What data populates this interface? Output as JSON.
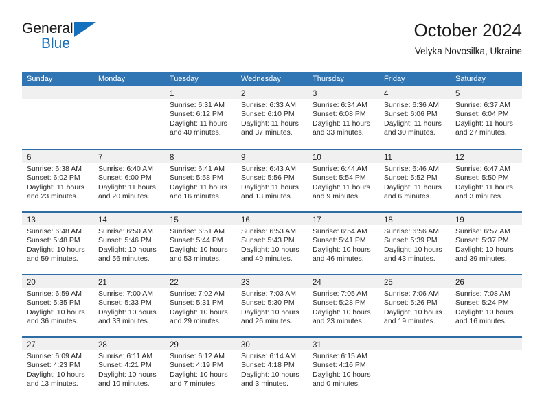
{
  "brand": {
    "name_top": "General",
    "name_bottom": "Blue",
    "accent_color": "#1570bd",
    "triangle_icon": "triangle-icon"
  },
  "header": {
    "title": "October 2024",
    "subtitle": "Velyka Novosilka, Ukraine"
  },
  "calendar": {
    "header_bg": "#3075b4",
    "row_divider_color": "#2e6da4",
    "daynum_band_color": "#f0f0f0",
    "weekdays": [
      "Sunday",
      "Monday",
      "Tuesday",
      "Wednesday",
      "Thursday",
      "Friday",
      "Saturday"
    ],
    "weeks": [
      [
        {
          "day": "",
          "lines": []
        },
        {
          "day": "",
          "lines": []
        },
        {
          "day": "1",
          "lines": [
            "Sunrise: 6:31 AM",
            "Sunset: 6:12 PM",
            "Daylight: 11 hours",
            "and 40 minutes."
          ]
        },
        {
          "day": "2",
          "lines": [
            "Sunrise: 6:33 AM",
            "Sunset: 6:10 PM",
            "Daylight: 11 hours",
            "and 37 minutes."
          ]
        },
        {
          "day": "3",
          "lines": [
            "Sunrise: 6:34 AM",
            "Sunset: 6:08 PM",
            "Daylight: 11 hours",
            "and 33 minutes."
          ]
        },
        {
          "day": "4",
          "lines": [
            "Sunrise: 6:36 AM",
            "Sunset: 6:06 PM",
            "Daylight: 11 hours",
            "and 30 minutes."
          ]
        },
        {
          "day": "5",
          "lines": [
            "Sunrise: 6:37 AM",
            "Sunset: 6:04 PM",
            "Daylight: 11 hours",
            "and 27 minutes."
          ]
        }
      ],
      [
        {
          "day": "6",
          "lines": [
            "Sunrise: 6:38 AM",
            "Sunset: 6:02 PM",
            "Daylight: 11 hours",
            "and 23 minutes."
          ]
        },
        {
          "day": "7",
          "lines": [
            "Sunrise: 6:40 AM",
            "Sunset: 6:00 PM",
            "Daylight: 11 hours",
            "and 20 minutes."
          ]
        },
        {
          "day": "8",
          "lines": [
            "Sunrise: 6:41 AM",
            "Sunset: 5:58 PM",
            "Daylight: 11 hours",
            "and 16 minutes."
          ]
        },
        {
          "day": "9",
          "lines": [
            "Sunrise: 6:43 AM",
            "Sunset: 5:56 PM",
            "Daylight: 11 hours",
            "and 13 minutes."
          ]
        },
        {
          "day": "10",
          "lines": [
            "Sunrise: 6:44 AM",
            "Sunset: 5:54 PM",
            "Daylight: 11 hours",
            "and 9 minutes."
          ]
        },
        {
          "day": "11",
          "lines": [
            "Sunrise: 6:46 AM",
            "Sunset: 5:52 PM",
            "Daylight: 11 hours",
            "and 6 minutes."
          ]
        },
        {
          "day": "12",
          "lines": [
            "Sunrise: 6:47 AM",
            "Sunset: 5:50 PM",
            "Daylight: 11 hours",
            "and 3 minutes."
          ]
        }
      ],
      [
        {
          "day": "13",
          "lines": [
            "Sunrise: 6:48 AM",
            "Sunset: 5:48 PM",
            "Daylight: 10 hours",
            "and 59 minutes."
          ]
        },
        {
          "day": "14",
          "lines": [
            "Sunrise: 6:50 AM",
            "Sunset: 5:46 PM",
            "Daylight: 10 hours",
            "and 56 minutes."
          ]
        },
        {
          "day": "15",
          "lines": [
            "Sunrise: 6:51 AM",
            "Sunset: 5:44 PM",
            "Daylight: 10 hours",
            "and 53 minutes."
          ]
        },
        {
          "day": "16",
          "lines": [
            "Sunrise: 6:53 AM",
            "Sunset: 5:43 PM",
            "Daylight: 10 hours",
            "and 49 minutes."
          ]
        },
        {
          "day": "17",
          "lines": [
            "Sunrise: 6:54 AM",
            "Sunset: 5:41 PM",
            "Daylight: 10 hours",
            "and 46 minutes."
          ]
        },
        {
          "day": "18",
          "lines": [
            "Sunrise: 6:56 AM",
            "Sunset: 5:39 PM",
            "Daylight: 10 hours",
            "and 43 minutes."
          ]
        },
        {
          "day": "19",
          "lines": [
            "Sunrise: 6:57 AM",
            "Sunset: 5:37 PM",
            "Daylight: 10 hours",
            "and 39 minutes."
          ]
        }
      ],
      [
        {
          "day": "20",
          "lines": [
            "Sunrise: 6:59 AM",
            "Sunset: 5:35 PM",
            "Daylight: 10 hours",
            "and 36 minutes."
          ]
        },
        {
          "day": "21",
          "lines": [
            "Sunrise: 7:00 AM",
            "Sunset: 5:33 PM",
            "Daylight: 10 hours",
            "and 33 minutes."
          ]
        },
        {
          "day": "22",
          "lines": [
            "Sunrise: 7:02 AM",
            "Sunset: 5:31 PM",
            "Daylight: 10 hours",
            "and 29 minutes."
          ]
        },
        {
          "day": "23",
          "lines": [
            "Sunrise: 7:03 AM",
            "Sunset: 5:30 PM",
            "Daylight: 10 hours",
            "and 26 minutes."
          ]
        },
        {
          "day": "24",
          "lines": [
            "Sunrise: 7:05 AM",
            "Sunset: 5:28 PM",
            "Daylight: 10 hours",
            "and 23 minutes."
          ]
        },
        {
          "day": "25",
          "lines": [
            "Sunrise: 7:06 AM",
            "Sunset: 5:26 PM",
            "Daylight: 10 hours",
            "and 19 minutes."
          ]
        },
        {
          "day": "26",
          "lines": [
            "Sunrise: 7:08 AM",
            "Sunset: 5:24 PM",
            "Daylight: 10 hours",
            "and 16 minutes."
          ]
        }
      ],
      [
        {
          "day": "27",
          "lines": [
            "Sunrise: 6:09 AM",
            "Sunset: 4:23 PM",
            "Daylight: 10 hours",
            "and 13 minutes."
          ]
        },
        {
          "day": "28",
          "lines": [
            "Sunrise: 6:11 AM",
            "Sunset: 4:21 PM",
            "Daylight: 10 hours",
            "and 10 minutes."
          ]
        },
        {
          "day": "29",
          "lines": [
            "Sunrise: 6:12 AM",
            "Sunset: 4:19 PM",
            "Daylight: 10 hours",
            "and 7 minutes."
          ]
        },
        {
          "day": "30",
          "lines": [
            "Sunrise: 6:14 AM",
            "Sunset: 4:18 PM",
            "Daylight: 10 hours",
            "and 3 minutes."
          ]
        },
        {
          "day": "31",
          "lines": [
            "Sunrise: 6:15 AM",
            "Sunset: 4:16 PM",
            "Daylight: 10 hours",
            "and 0 minutes."
          ]
        },
        {
          "day": "",
          "lines": []
        },
        {
          "day": "",
          "lines": []
        }
      ]
    ]
  }
}
